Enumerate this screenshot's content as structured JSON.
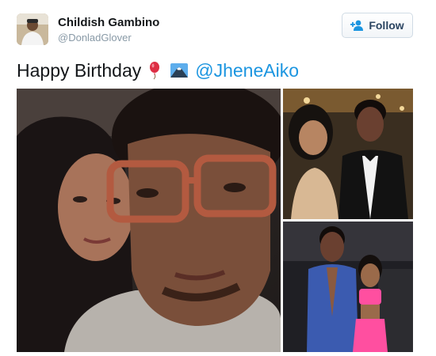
{
  "author": {
    "display_name": "Childish Gambino",
    "handle": "@DonladGlover"
  },
  "follow_button": {
    "label": "Follow",
    "icon": "add-user-icon"
  },
  "tweet": {
    "text": "Happy Birthday",
    "emojis": [
      "balloon-emoji",
      "mount-fuji-emoji"
    ],
    "mention": "@JheneAiko"
  },
  "media": {
    "count": 3,
    "items": [
      "selfie-photo",
      "red-carpet-photo",
      "event-photo"
    ]
  },
  "colors": {
    "link": "#1b95e0",
    "text": "#14171a",
    "secondary": "#8899a6",
    "follow_text": "#2b4561"
  }
}
